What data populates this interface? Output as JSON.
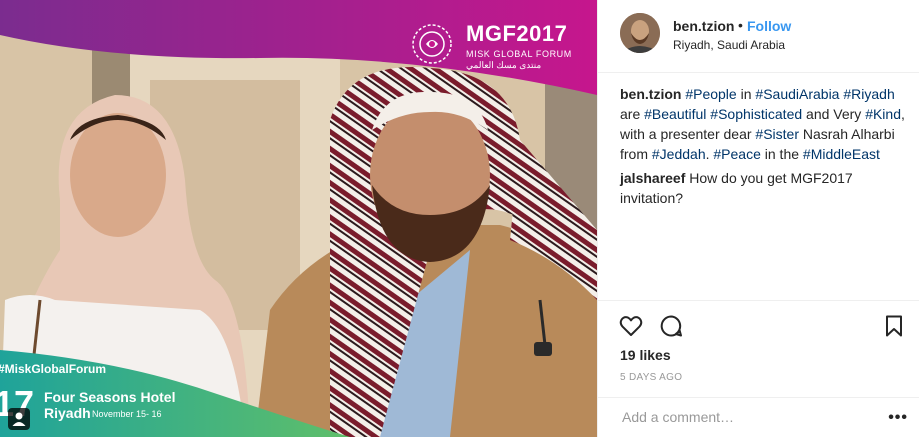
{
  "photo": {
    "brand_title": "MGF2017",
    "brand_subtitle": "MISK GLOBAL FORUM",
    "brand_arabic": "منتدى مسك العالمي",
    "hashtag": "#MiskGlobalForum",
    "year_fragment": "17",
    "venue": "Four Seasons Hotel",
    "city": "Riyadh",
    "dates": "November 15- 16",
    "colors": {
      "magenta": "#c6168d",
      "purple": "#7b2c8f",
      "teal": "#1fa39a",
      "green": "#5fbf6a"
    }
  },
  "header": {
    "username": "ben.tzion",
    "separator": "•",
    "follow_label": "Follow",
    "location": "Riyadh, Saudi Arabia"
  },
  "caption": {
    "user": "ben.tzion",
    "segments": [
      {
        "text": "#People",
        "tag": true
      },
      {
        "text": " in ",
        "tag": false
      },
      {
        "text": "#SaudiArabia",
        "tag": true
      },
      {
        "text": " ",
        "tag": false
      },
      {
        "text": "#Riyadh",
        "tag": true
      },
      {
        "text": " are ",
        "tag": false
      },
      {
        "text": "#Beautiful",
        "tag": true
      },
      {
        "text": " ",
        "tag": false
      },
      {
        "text": "#Sophisticated",
        "tag": true
      },
      {
        "text": " and Very ",
        "tag": false
      },
      {
        "text": "#Kind",
        "tag": true
      },
      {
        "text": ", with a presenter dear ",
        "tag": false
      },
      {
        "text": "#Sister",
        "tag": true
      },
      {
        "text": " Nasrah Alharbi from ",
        "tag": false
      },
      {
        "text": "#Jeddah",
        "tag": true
      },
      {
        "text": ". ",
        "tag": false
      },
      {
        "text": "#Peace",
        "tag": true
      },
      {
        "text": " in the ",
        "tag": false
      },
      {
        "text": "#MiddleEast",
        "tag": true
      }
    ]
  },
  "comment": {
    "user": "jalshareef",
    "text": "How do you get MGF2017 invitation?"
  },
  "actions": {
    "icons": [
      "heart-icon",
      "comment-icon",
      "bookmark-icon"
    ],
    "likes": "19 likes",
    "time": "5 DAYS AGO"
  },
  "add_comment": {
    "placeholder": "Add a comment…",
    "more": "•••"
  }
}
